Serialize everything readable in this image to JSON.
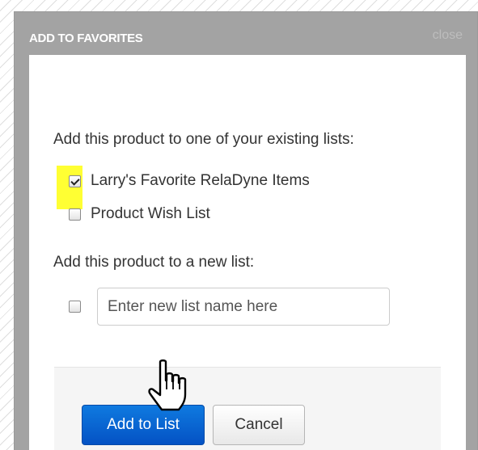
{
  "dialog": {
    "title": "ADD TO FAVORITES",
    "close_label": "close"
  },
  "existing_lists": {
    "prompt": "Add this product to one of your existing lists:",
    "items": [
      {
        "label": "Larry's Favorite RelaDyne Items",
        "checked": true
      },
      {
        "label": "Product Wish List",
        "checked": false
      }
    ]
  },
  "new_list": {
    "prompt": "Add this product to a new list:",
    "checked": false,
    "input_value": "",
    "input_placeholder": "Enter new list name here"
  },
  "footer": {
    "add_label": "Add to List",
    "cancel_label": "Cancel"
  },
  "colors": {
    "primary_button": "#0461d2",
    "highlight": "#ffff33",
    "header_bg": "#a3a3a3"
  },
  "icons": {
    "pointer": "hand-pointer-icon",
    "check": "checkmark-icon"
  }
}
